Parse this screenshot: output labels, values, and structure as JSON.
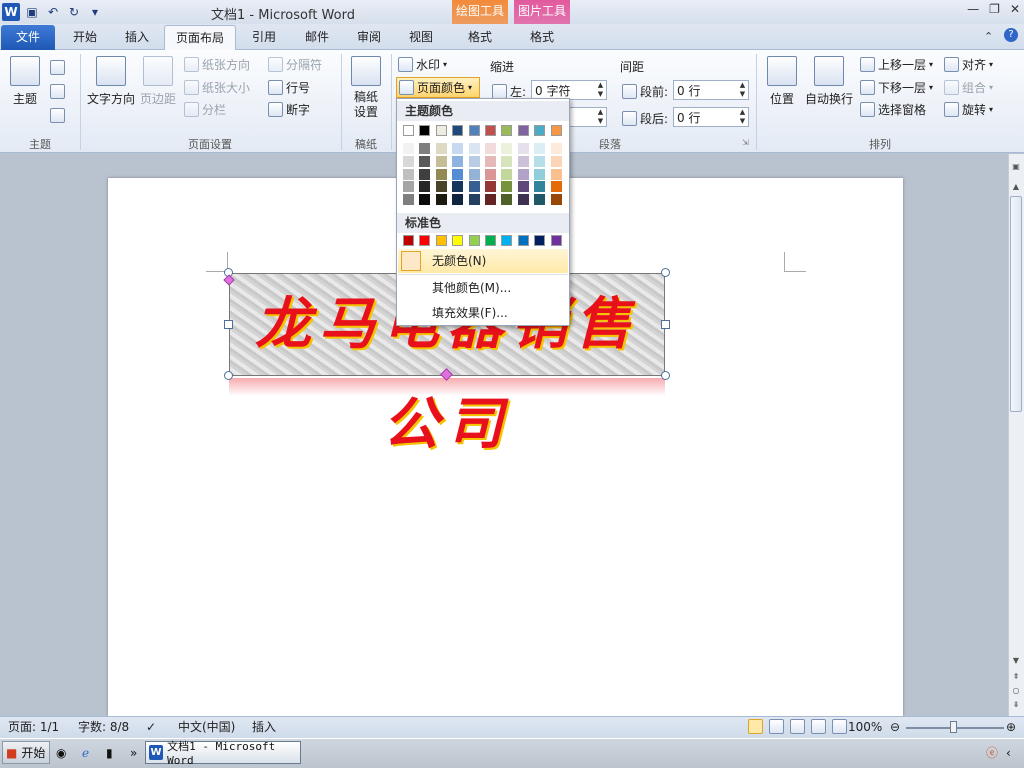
{
  "titlebar": {
    "title": "文档1 - Microsoft Word",
    "context_tools": [
      {
        "group": "绘图工具",
        "tab": "格式",
        "color": "#f28a3a"
      },
      {
        "group": "图片工具",
        "tab": "格式",
        "color": "#e2599e"
      }
    ]
  },
  "tabs": [
    "文件",
    "开始",
    "插入",
    "页面布局",
    "引用",
    "邮件",
    "审阅",
    "视图"
  ],
  "ribbon": {
    "theme_group": {
      "label": "主题",
      "btn": "主题"
    },
    "page_setup": {
      "label": "页面设置",
      "text_direction": "文字方向",
      "margins": "页边距",
      "orientation": "纸张方向",
      "size": "纸张大小",
      "columns": "分栏",
      "breaks": "分隔符",
      "line_numbers": "行号",
      "hyphenation": "断字"
    },
    "manuscript": {
      "label": "稿纸",
      "btn": "稿纸\n设置"
    },
    "background": {
      "watermark": "水印",
      "page_color": "页面颜色"
    },
    "paragraph": {
      "label": "段落",
      "indent_title": "缩进",
      "left_label": "左:",
      "left_value": "0 字符",
      "spacing_title": "间距",
      "before_label": "段前:",
      "before_value": "0 行",
      "after_label": "段后:",
      "after_value": "0 行"
    },
    "arrange": {
      "label": "排列",
      "position": "位置",
      "wrap": "自动换行",
      "bring_forward": "上移一层",
      "send_backward": "下移一层",
      "selection_pane": "选择窗格",
      "align": "对齐",
      "group": "组合",
      "rotate": "旋转"
    }
  },
  "color_menu": {
    "theme_title": "主题颜色",
    "standard_title": "标准色",
    "theme_colors": [
      "#ffffff",
      "#000000",
      "#eeece1",
      "#1f497d",
      "#4f81bd",
      "#c0504d",
      "#9bbb59",
      "#8064a2",
      "#4bacc6",
      "#f79646"
    ],
    "theme_tints": [
      [
        "#f2f2f2",
        "#d8d8d8",
        "#bfbfbf",
        "#a5a5a5",
        "#7f7f7f"
      ],
      [
        "#7f7f7f",
        "#595959",
        "#3f3f3f",
        "#262626",
        "#0c0c0c"
      ],
      [
        "#ddd9c3",
        "#c4bd97",
        "#938953",
        "#494429",
        "#1d1b10"
      ],
      [
        "#c6d9f0",
        "#8db3e2",
        "#548dd4",
        "#17365d",
        "#0f243e"
      ],
      [
        "#dbe5f1",
        "#b8cce4",
        "#95b3d7",
        "#366092",
        "#244061"
      ],
      [
        "#f2dcdb",
        "#e5b9b7",
        "#d99694",
        "#953734",
        "#632423"
      ],
      [
        "#ebf1dd",
        "#d7e3bc",
        "#c3d69b",
        "#76923c",
        "#4f6128"
      ],
      [
        "#e5e0ec",
        "#ccc1d9",
        "#b2a2c7",
        "#5f497a",
        "#3f3151"
      ],
      [
        "#dbeef3",
        "#b7dde8",
        "#92cddc",
        "#31859b",
        "#205867"
      ],
      [
        "#fdeada",
        "#fbd5b5",
        "#fac08f",
        "#e36c09",
        "#974806"
      ]
    ],
    "standard_colors": [
      "#c00000",
      "#ff0000",
      "#ffc000",
      "#ffff00",
      "#92d050",
      "#00b050",
      "#00b0f0",
      "#0070c0",
      "#002060",
      "#7030a0"
    ],
    "no_color": "无颜色(N)",
    "more_colors": "其他颜色(M)...",
    "fill_effects": "填充效果(F)..."
  },
  "wordart": {
    "text": "龙马电器销售公司"
  },
  "statusbar": {
    "page": "页面: 1/1",
    "words": "字数: 8/8",
    "language": "中文(中国)",
    "mode": "插入",
    "zoom": "100%"
  },
  "taskbar": {
    "start": "开始",
    "window": "文档1 - Microsoft Word"
  }
}
